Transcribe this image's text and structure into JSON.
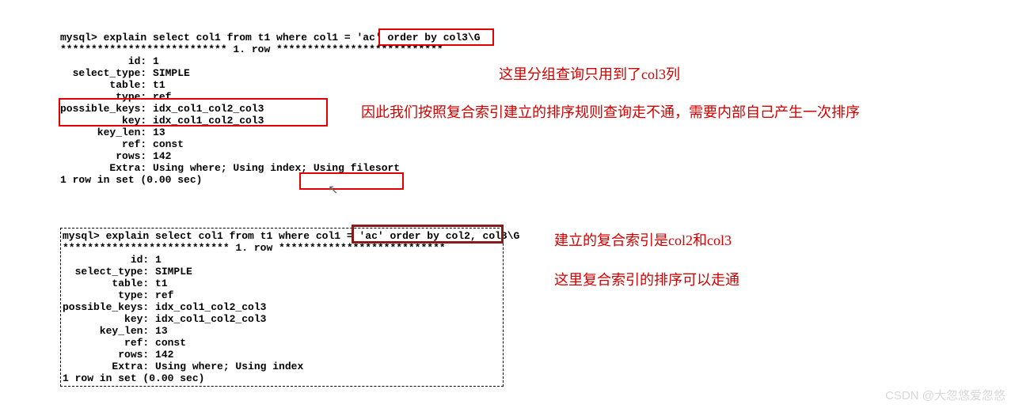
{
  "block1": {
    "prompt": "mysql>",
    "query_pre": "explain select col1 from t1 where col1 = 'ac'",
    "query_boxed": "order by col3\\G",
    "row_header": "*************************** 1. row ***************************",
    "fields": {
      "id": "           id: 1",
      "select_type": "  select_type: SIMPLE",
      "table": "        table: t1",
      "type": "         type: ref",
      "possible_keys": "possible_keys: idx_col1_col2_col3",
      "key": "          key: idx_col1_col2_col3",
      "key_len": "      key_len: 13",
      "ref": "          ref: const",
      "rows": "         rows: 142",
      "extra_pre": "        Extra: Using where; Using index;",
      "extra_box": "Using filesort"
    },
    "footer": "1 row in set (0.00 sec)"
  },
  "block2": {
    "prompt": "mysql>",
    "query_pre": "explain select col1 from t1 where col1 = 'ac'",
    "query_boxed": "order by col2, col3\\G",
    "row_header": "*************************** 1. row ***************************",
    "fields": {
      "id": "           id: 1",
      "select_type": "  select_type: SIMPLE",
      "table": "        table: t1",
      "type": "         type: ref",
      "possible_keys": "possible_keys: idx_col1_col2_col3",
      "key": "          key: idx_col1_col2_col3",
      "key_len": "      key_len: 13",
      "ref": "          ref: const",
      "rows": "         rows: 142",
      "extra": "        Extra: Using where; Using index"
    },
    "footer": "1 row in set (0.00 sec)"
  },
  "annotations": {
    "a1": "这里分组查询只用到了col3列",
    "a2": "因此我们按照复合索引建立的排序规则查询走不通，需要内部自己产生一次排序",
    "a3": "建立的复合索引是col2和col3",
    "a4": "这里复合索引的排序可以走通"
  },
  "watermark": "CSDN @大忽悠爱忽悠",
  "cursor_glyph": "↖"
}
